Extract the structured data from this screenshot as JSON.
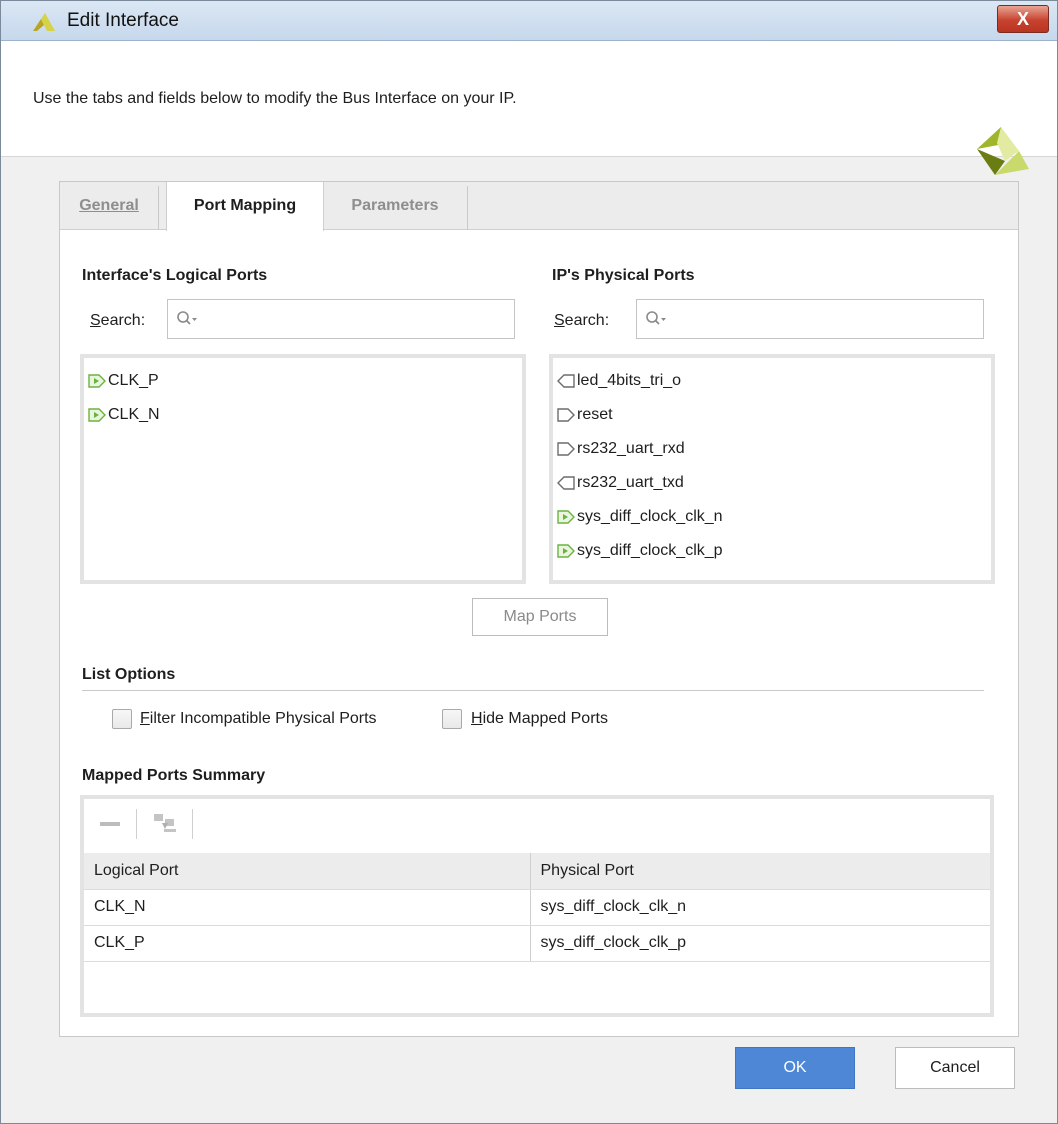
{
  "window": {
    "title": "Edit Interface",
    "close_label": "X"
  },
  "banner": {
    "description": "Use the tabs and fields below to modify the Bus Interface on your IP."
  },
  "tabs": [
    {
      "label": "General",
      "active": false
    },
    {
      "label": "Port Mapping",
      "active": true
    },
    {
      "label": "Parameters",
      "active": false
    }
  ],
  "logical_ports": {
    "title": "Interface's Logical Ports",
    "search_label": "Search:",
    "search_icon": "search-icon",
    "items": [
      {
        "label": "CLK_P",
        "icon": "input-port-icon"
      },
      {
        "label": "CLK_N",
        "icon": "input-port-icon"
      }
    ]
  },
  "physical_ports": {
    "title": "IP's Physical Ports",
    "search_label": "Search:",
    "search_icon": "search-icon",
    "items": [
      {
        "label": "led_4bits_tri_o",
        "icon": "output-port-icon"
      },
      {
        "label": "reset",
        "icon": "input-port-icon"
      },
      {
        "label": "rs232_uart_rxd",
        "icon": "input-port-icon"
      },
      {
        "label": "rs232_uart_txd",
        "icon": "output-port-icon"
      },
      {
        "label": "sys_diff_clock_clk_n",
        "icon": "mapped-input-port-icon"
      },
      {
        "label": "sys_diff_clock_clk_p",
        "icon": "mapped-input-port-icon"
      }
    ]
  },
  "map_ports_label": "Map Ports",
  "list_options": {
    "title": "List Options",
    "filter_label": "Filter Incompatible Physical Ports",
    "filter_checked": false,
    "hide_label": "Hide Mapped Ports",
    "hide_checked": false
  },
  "summary": {
    "title": "Mapped Ports Summary",
    "toolbar": [
      "remove-icon",
      "auto-map-icon"
    ],
    "columns": [
      "Logical Port",
      "Physical Port"
    ],
    "rows": [
      [
        "CLK_N",
        "sys_diff_clock_clk_n"
      ],
      [
        "CLK_P",
        "sys_diff_clock_clk_p"
      ]
    ]
  },
  "footer": {
    "ok_label": "OK",
    "cancel_label": "Cancel"
  },
  "colors": {
    "accent": "#4d87d6",
    "port_green": "#6bb33f",
    "close_red": "#c7432f"
  }
}
